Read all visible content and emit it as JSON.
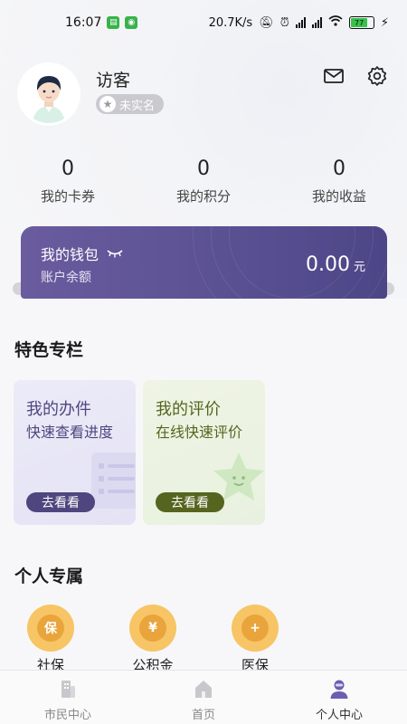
{
  "status_bar": {
    "time": "16:07",
    "network_speed": "20.7K/s",
    "battery_level": "77"
  },
  "profile": {
    "username": "访客",
    "verify_status": "未实名"
  },
  "stats": [
    {
      "value": "0",
      "label": "我的卡券"
    },
    {
      "value": "0",
      "label": "我的积分"
    },
    {
      "value": "0",
      "label": "我的收益"
    }
  ],
  "wallet": {
    "title": "我的钱包",
    "subtitle": "账户余额",
    "amount": "0.00",
    "unit": "元"
  },
  "featured": {
    "title": "特色专栏",
    "cards": [
      {
        "title": "我的办件",
        "subtitle": "快速查看进度",
        "button": "去看看"
      },
      {
        "title": "我的评价",
        "subtitle": "在线快速评价",
        "button": "去看看"
      }
    ]
  },
  "personal": {
    "title": "个人专属",
    "services": [
      {
        "label": "社保",
        "glyph": "保"
      },
      {
        "label": "公积金",
        "glyph": "¥"
      },
      {
        "label": "医保",
        "glyph": "+"
      }
    ]
  },
  "tabbar": {
    "tabs": [
      {
        "label": "市民中心"
      },
      {
        "label": "首页"
      },
      {
        "label": "个人中心"
      }
    ]
  },
  "colors": {
    "wallet": "#5a5193",
    "card1_accent": "#4f467f",
    "card2_accent": "#55651f",
    "service": "#f7c565"
  }
}
